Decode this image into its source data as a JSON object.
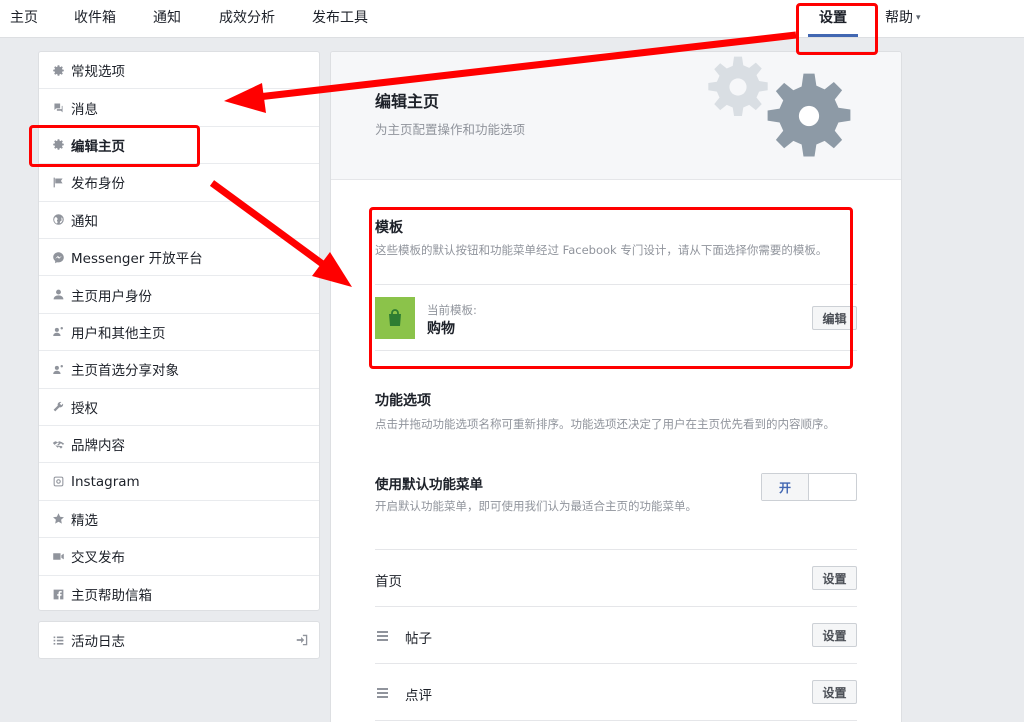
{
  "topnav": {
    "items": [
      {
        "label": "主页"
      },
      {
        "label": "收件箱"
      },
      {
        "label": "通知"
      },
      {
        "label": "成效分析"
      },
      {
        "label": "发布工具"
      }
    ],
    "settings": "设置",
    "help": "帮助",
    "help_caret": "▾"
  },
  "sidebar": {
    "items": [
      {
        "label": "常规选项",
        "icon": "gear-icon"
      },
      {
        "label": "消息",
        "icon": "message-icon"
      },
      {
        "label": "编辑主页",
        "icon": "gear-icon"
      },
      {
        "label": "发布身份",
        "icon": "flag-icon"
      },
      {
        "label": "通知",
        "icon": "globe-icon"
      },
      {
        "label": "Messenger 开放平台",
        "icon": "messenger-icon"
      },
      {
        "label": "主页用户身份",
        "icon": "person-icon"
      },
      {
        "label": "用户和其他主页",
        "icon": "people-icon"
      },
      {
        "label": "主页首选分享对象",
        "icon": "people-icon"
      },
      {
        "label": "授权",
        "icon": "wrench-icon"
      },
      {
        "label": "品牌内容",
        "icon": "handshake-icon"
      },
      {
        "label": "Instagram",
        "icon": "instagram-icon"
      },
      {
        "label": "精选",
        "icon": "star-icon"
      },
      {
        "label": "交叉发布",
        "icon": "video-icon"
      },
      {
        "label": "主页帮助信箱",
        "icon": "facebook-icon"
      }
    ],
    "activity_log": "活动日志"
  },
  "main": {
    "title": "编辑主页",
    "subtitle": "为主页配置操作和功能选项",
    "template": {
      "title": "模板",
      "desc": "这些模板的默认按钮和功能菜单经过 Facebook 专门设计，请从下面选择你需要的模板。",
      "current_label": "当前模板:",
      "current_name": "购物",
      "edit_button": "编辑"
    },
    "tabs_section": {
      "title": "功能选项",
      "desc": "点击并拖动功能选项名称可重新排序。功能选项还决定了用户在主页优先看到的内容顺序。",
      "default_menu_title": "使用默认功能菜单",
      "default_menu_desc": "开启默认功能菜单，即可使用我们认为最适合主页的功能菜单。",
      "toggle_on": "开"
    },
    "tab_rows": [
      {
        "label": "首页",
        "button": "设置"
      },
      {
        "label": "帖子",
        "button": "设置"
      },
      {
        "label": "点评",
        "button": "设置"
      }
    ]
  },
  "colors": {
    "annotation": "#ff0000",
    "accent": "#4267b2",
    "template_icon": "#8bc34a"
  }
}
